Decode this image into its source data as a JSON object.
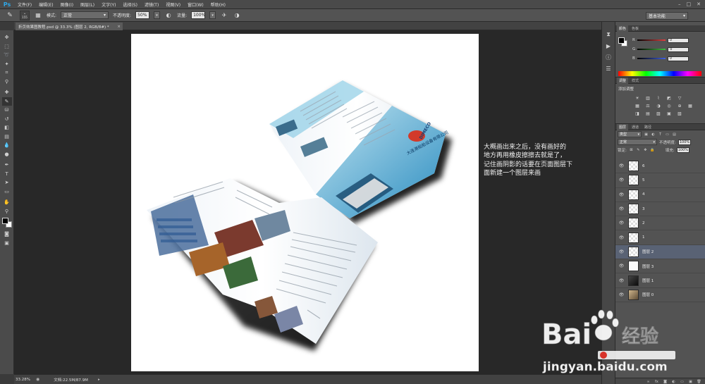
{
  "app": {
    "logo": "Ps"
  },
  "menubar": {
    "items": [
      "文件(F)",
      "编辑(E)",
      "图像(I)",
      "图层(L)",
      "文字(Y)",
      "选择(S)",
      "滤镜(T)",
      "视图(V)",
      "窗口(W)",
      "帮助(H)"
    ],
    "window_controls": [
      "–",
      "□",
      "✕"
    ]
  },
  "options": {
    "brush_size": "155",
    "mode_label": "模式:",
    "mode_value": "正常",
    "opacity_label": "不透明度:",
    "opacity_value": "50%",
    "flow_label": "流量:",
    "flow_value": "100%",
    "workspace": "基本功能"
  },
  "document": {
    "tab_title": "折页效果图教程.psd @ 33.3% (图层 2, RGB/8#) *",
    "close": "×"
  },
  "annotation": {
    "lines": [
      "大概画出来之后，没有画好的",
      "地方再用橡皮擦擦去就是了，",
      "记住画阴影的话要在页面图层下",
      "面新建一个图层来画"
    ]
  },
  "brochure": {
    "company": "DIMECO",
    "company_cn": "大连港船舶设备有限公司"
  },
  "status": {
    "zoom": "33.28%",
    "doc_info": "文档:22.5M/87.9M"
  },
  "color_panel": {
    "tabs": [
      "颜色",
      "色板"
    ],
    "channels": [
      {
        "label": "R",
        "value": "0",
        "color": "#e04040"
      },
      {
        "label": "G",
        "value": "0",
        "color": "#40c040"
      },
      {
        "label": "B",
        "value": "0",
        "color": "#4060e0"
      }
    ]
  },
  "adjustments_panel": {
    "tabs": [
      "调整",
      "样式"
    ],
    "title": "添加调整"
  },
  "layers_panel": {
    "tabs": [
      "图层",
      "通道",
      "路径"
    ],
    "kind_label": "类型",
    "blend_mode": "正常",
    "opacity_label": "不透明度:",
    "opacity_value": "100%",
    "lock_label": "锁定:",
    "fill_label": "填充:",
    "fill_value": "100%",
    "layers": [
      {
        "name": "6",
        "thumb": "checker",
        "selected": false
      },
      {
        "name": "5",
        "thumb": "checker",
        "selected": false
      },
      {
        "name": "4",
        "thumb": "checker",
        "selected": false
      },
      {
        "name": "3",
        "thumb": "checker",
        "selected": false
      },
      {
        "name": "2",
        "thumb": "checker",
        "selected": false
      },
      {
        "name": "1",
        "thumb": "checker",
        "selected": false
      },
      {
        "name": "图层 2",
        "thumb": "checker",
        "selected": true
      },
      {
        "name": "图层 3",
        "thumb": "white",
        "selected": false
      },
      {
        "name": "图层 1",
        "thumb": "dark",
        "selected": false
      },
      {
        "name": "图层 0",
        "thumb": "photo",
        "selected": false
      }
    ]
  },
  "watermark": {
    "brand": "Bai",
    "brand_suffix": "经验",
    "url": "jingyan.baidu.com"
  }
}
